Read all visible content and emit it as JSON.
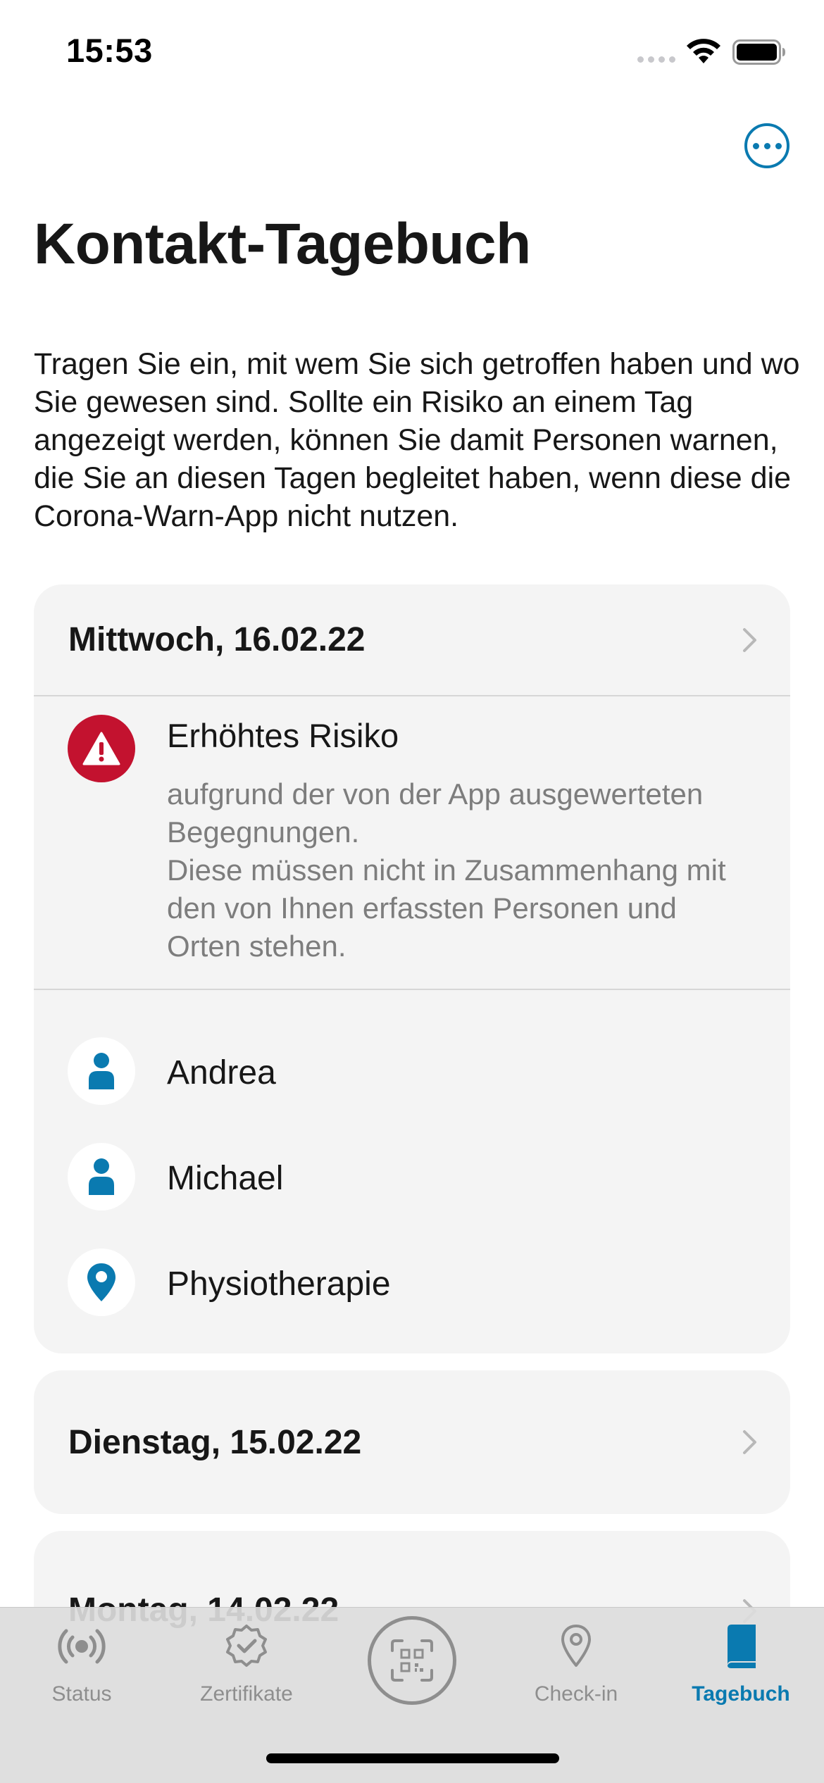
{
  "status_bar": {
    "time": "15:53"
  },
  "header": {
    "title": "Kontakt-Tagebuch",
    "more_icon": "ellipsis-circle-icon"
  },
  "intro": "Tragen Sie ein, mit wem Sie sich getroffen haben und wo Sie gewesen sind. Sollte ein Risiko an einem Tag angezeigt werden, können Sie damit Personen warnen, die Sie an diesen Tagen begleitet haben, wenn diese die Corona-Warn-App nicht nutzen.",
  "days": [
    {
      "date": "Mittwoch, 16.02.22",
      "risk": {
        "title": "Erhöhtes Risiko",
        "text": "aufgrund der von der App ausgewerteten Begegnungen.\nDiese müssen nicht in Zusammenhang mit den von Ihnen erfassten Personen und Orten stehen.",
        "icon": "warning-triangle-icon",
        "color": "#c3122f"
      },
      "entries": [
        {
          "label": "Andrea",
          "icon": "person-icon"
        },
        {
          "label": "Michael",
          "icon": "person-icon"
        },
        {
          "label": "Physiotherapie",
          "icon": "location-pin-icon"
        }
      ]
    },
    {
      "date": "Dienstag, 15.02.22"
    },
    {
      "date": "Montag, 14.02.22"
    }
  ],
  "tab_bar": {
    "tabs": [
      {
        "label": "Status",
        "icon": "radar-icon"
      },
      {
        "label": "Zertifikate",
        "icon": "certificate-badge-icon"
      },
      {
        "label": "Check-in",
        "icon": "location-pin-icon"
      },
      {
        "label": "Tagebuch",
        "icon": "book-icon",
        "active": true
      }
    ],
    "scan_icon": "qr-scan-icon"
  },
  "colors": {
    "accent": "#0a7ab0",
    "risk": "#c3122f",
    "card": "#f4f4f4",
    "inactive": "#8e8e8e"
  }
}
